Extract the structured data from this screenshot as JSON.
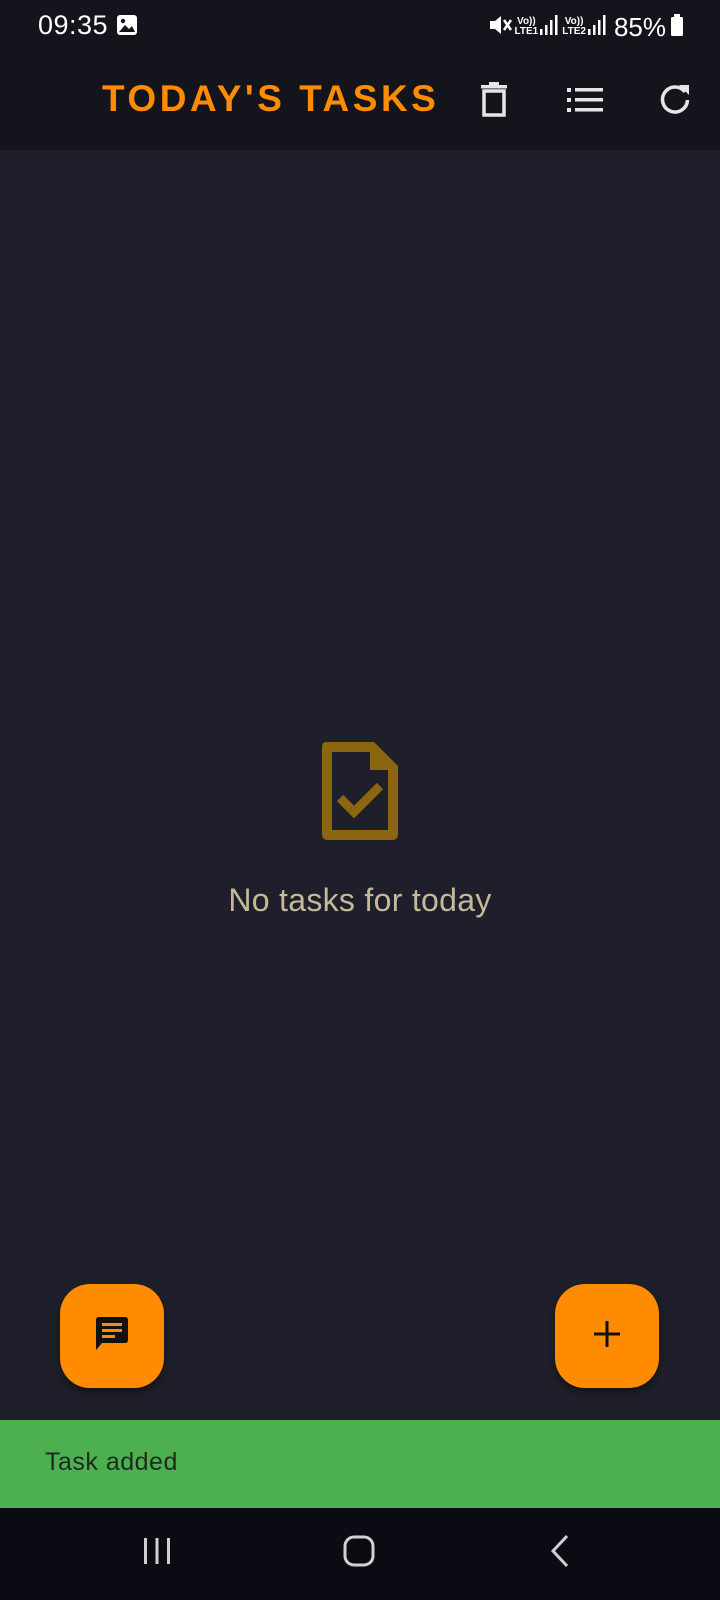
{
  "status_bar": {
    "time": "09:35",
    "sim1_top": "Vo))",
    "sim1_bottom": "LTE1",
    "sim2_top": "Vo))",
    "sim2_bottom": "LTE2",
    "battery": "85%",
    "icons": [
      "gallery-icon",
      "mute-icon",
      "signal-icon",
      "battery-icon"
    ]
  },
  "app_bar": {
    "title": "TODAY'S TASKS",
    "actions": [
      "delete-icon",
      "list-icon",
      "refresh-icon"
    ]
  },
  "empty_state": {
    "icon": "task-done-icon",
    "message": "No tasks for today"
  },
  "fabs": {
    "left_icon": "message-icon",
    "right_icon": "add-icon"
  },
  "snackbar": {
    "message": "Task added"
  },
  "nav_bar": {
    "icons": [
      "recents-icon",
      "home-icon",
      "back-icon"
    ]
  },
  "colors": {
    "accent": "#ff8c00",
    "background": "#1e1f2a",
    "app_bar": "#13141c",
    "snackbar": "#4caf50",
    "empty_icon": "#8c6510",
    "empty_text": "#c8b89a"
  }
}
